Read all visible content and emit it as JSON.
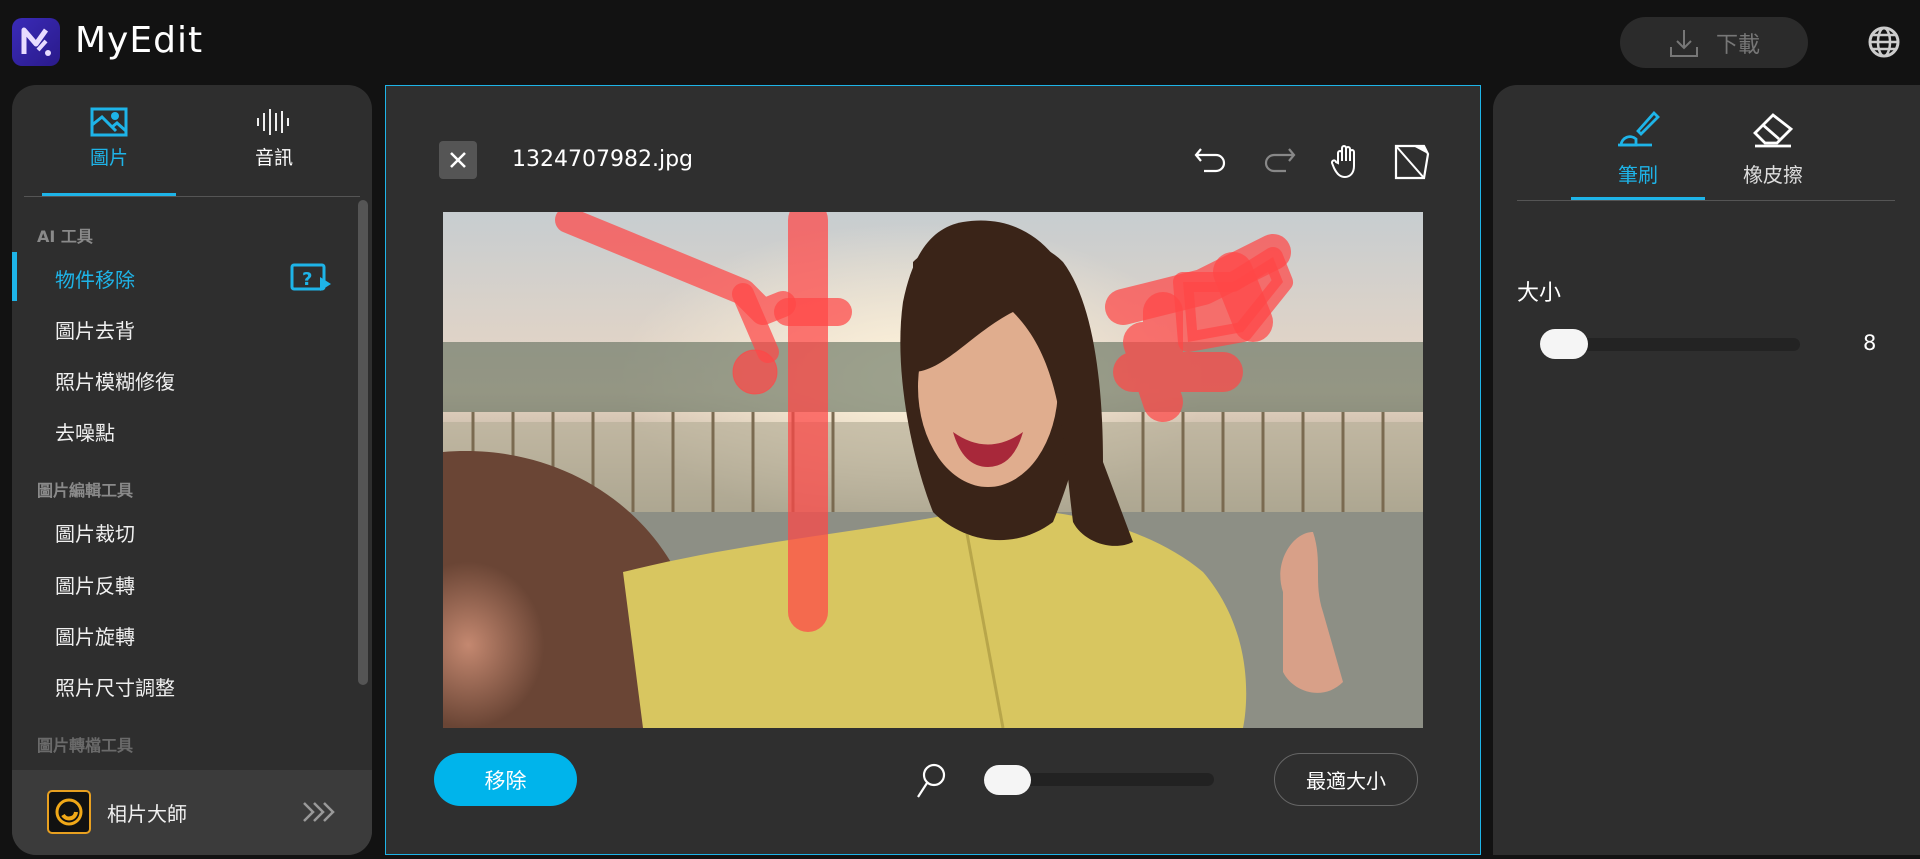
{
  "app": {
    "name": "MyEdit",
    "download_label": "下載"
  },
  "left": {
    "tabs": [
      {
        "label": "圖片",
        "active": true
      },
      {
        "label": "音訊",
        "active": false
      }
    ],
    "sections": [
      {
        "title": "AI 工具",
        "items": [
          "物件移除",
          "圖片去背",
          "照片模糊修復",
          "去噪點"
        ]
      },
      {
        "title": "圖片編輯工具",
        "items": [
          "圖片裁切",
          "圖片反轉",
          "圖片旋轉",
          "照片尺寸調整"
        ]
      },
      {
        "title": "圖片轉檔工具",
        "items": []
      }
    ],
    "active_item": "物件移除",
    "footer_label": "相片大師"
  },
  "editor": {
    "filename": "1324707982.jpg",
    "remove_label": "移除",
    "fit_label": "最適大小",
    "zoom_level": 0
  },
  "right": {
    "tabs": [
      {
        "label": "筆刷",
        "active": true
      },
      {
        "label": "橡皮擦",
        "active": false
      }
    ],
    "size_label": "大小",
    "size_value": "8"
  },
  "colors": {
    "accent": "#1eb4e8",
    "button": "#00b4eb",
    "mask": "#ff4646"
  }
}
